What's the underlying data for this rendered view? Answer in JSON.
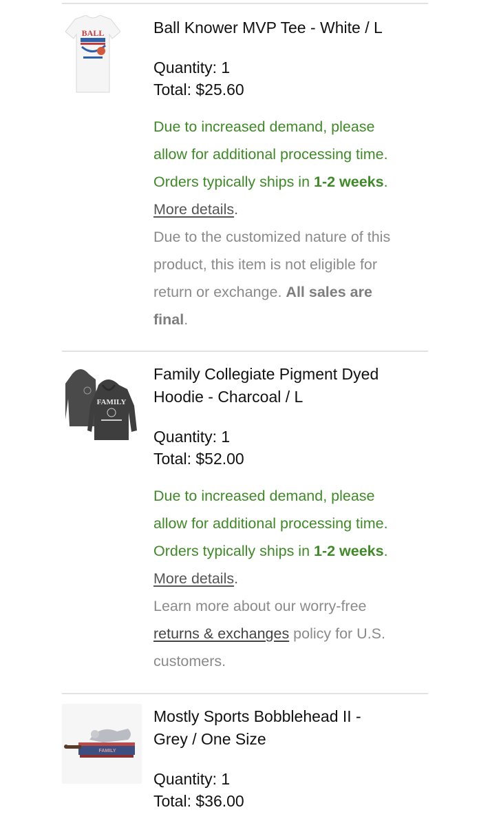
{
  "items": [
    {
      "title": "Ball Knower MVP Tee - White / L",
      "quantity": "Quantity: 1",
      "total": "Total: $25.60",
      "image_logo_text": "BALL",
      "notice_line1": "Due to increased demand, please",
      "notice_line2": "allow for additional processing time.",
      "notice_line3_pre": "Orders typically ships in ",
      "notice_line3_bold": "1-2 weeks",
      "notice_line3_post": ".",
      "more_details": "More details",
      "more_details_post": ".",
      "policy_line1": "Due to the customized nature of this",
      "policy_line2": "product, this item is not eligible for",
      "policy_line3_pre": "return or exchange. ",
      "policy_line3_bold": "All sales are",
      "policy_line4_bold": "final",
      "policy_line4_post": "."
    },
    {
      "title_line1": "Family Collegiate Pigment Dyed",
      "title_line2": "Hoodie - Charcoal / L",
      "quantity": "Quantity: 1",
      "total": "Total: $52.00",
      "image_logo_text": "FAMILY",
      "notice_line1": "Due to increased demand, please",
      "notice_line2": "allow for additional processing time.",
      "notice_line3_pre": "Orders typically ships in ",
      "notice_line3_bold": "1-2 weeks",
      "notice_line3_post": ".",
      "more_details": "More details",
      "more_details_post": ".",
      "policy_line1": "Learn more about our worry-free",
      "policy_link": "returns & exchanges",
      "policy_line2_post": " policy for U.S.",
      "policy_line3": "customers."
    },
    {
      "title_line1": "Mostly Sports Bobblehead II -",
      "title_line2": "Grey / One Size",
      "quantity": "Quantity: 1",
      "total": "Total: $36.00",
      "image_logo_text": "FAMILY"
    }
  ],
  "colors": {
    "notice_green": "#3e8a26",
    "policy_grey": "#8a8a8a",
    "divider": "#e2e2e2"
  }
}
